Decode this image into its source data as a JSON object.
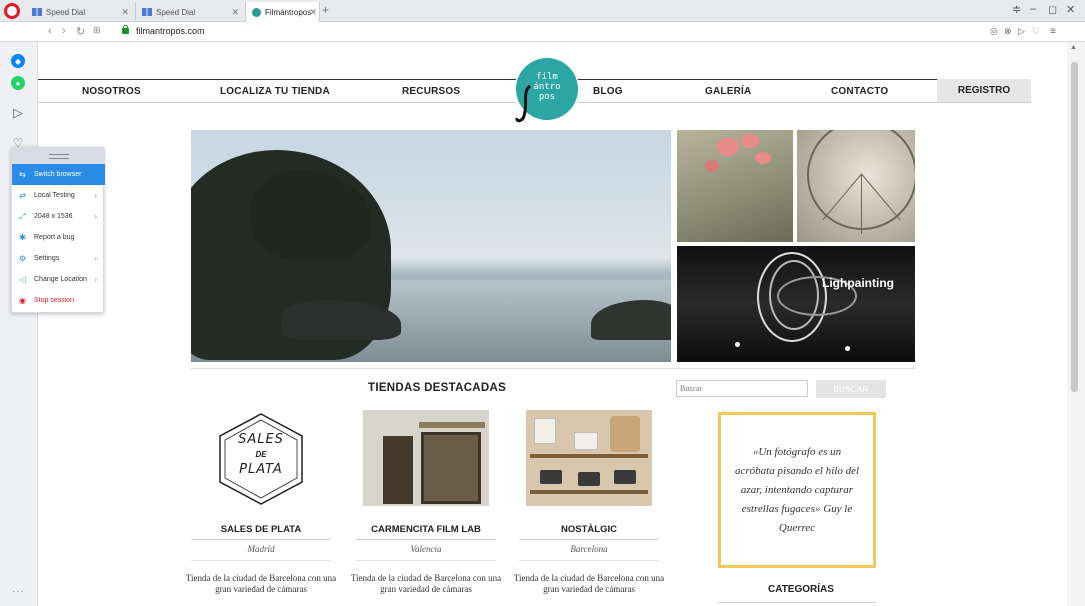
{
  "browser": {
    "tabs": [
      {
        "label": "Speed Dial"
      },
      {
        "label": "Speed Dial"
      },
      {
        "label": "Filmántropos – Comunida"
      }
    ],
    "new_tab": "+",
    "url": "filmantropos.com",
    "win": {
      "min": "–",
      "max": "◻",
      "close": "✕",
      "menu": "≡"
    }
  },
  "site": {
    "nav": {
      "nosotros": "NOSOTROS",
      "localiza": "LOCALIZA TU TIENDA",
      "recursos": "RECURSOS",
      "blog": "BLOG",
      "galeria": "GALERÍA",
      "contacto": "CONTACTO",
      "registro": "REGISTRO"
    },
    "logo": {
      "line1": "film",
      "line2": "ántro",
      "line3": "pos"
    },
    "gallery_label": "Lighpainting",
    "section_title": "TIENDAS DESTACADAS",
    "search": {
      "placeholder": "Buscar",
      "button": "BUSCAR"
    },
    "stores": [
      {
        "name": "SALES DE PLATA",
        "city": "Madrid",
        "desc": "Tienda de la ciudad de Barcelona con una gran variedad de cámaras",
        "logo_l1": "SALES",
        "logo_l2": "DE",
        "logo_l3": "PLATA"
      },
      {
        "name": "CARMENCITA FILM LAB",
        "city": "Valencia",
        "desc": "Tienda de la ciudad de Barcelona con una gran variedad de cámaras"
      },
      {
        "name": "NOSTÀLGIC",
        "city": "Barcelona",
        "desc": "Tienda de la ciudad de Barcelona con una gran variedad de cámaras"
      }
    ],
    "quote": "«Un fotógrafo es un acróbata pisando el hilo del azar, intentando capturar estrellas fugaces» Guy le Querrec",
    "categories_title": "CATEGORÍAS"
  },
  "tool_panel": {
    "items": [
      {
        "label": "Switch browser"
      },
      {
        "label": "Local Testing"
      },
      {
        "label": "2048 x 1536"
      },
      {
        "label": "Report a bug"
      },
      {
        "label": "Settings"
      },
      {
        "label": "Change Location"
      },
      {
        "label": "Stop session"
      }
    ]
  }
}
